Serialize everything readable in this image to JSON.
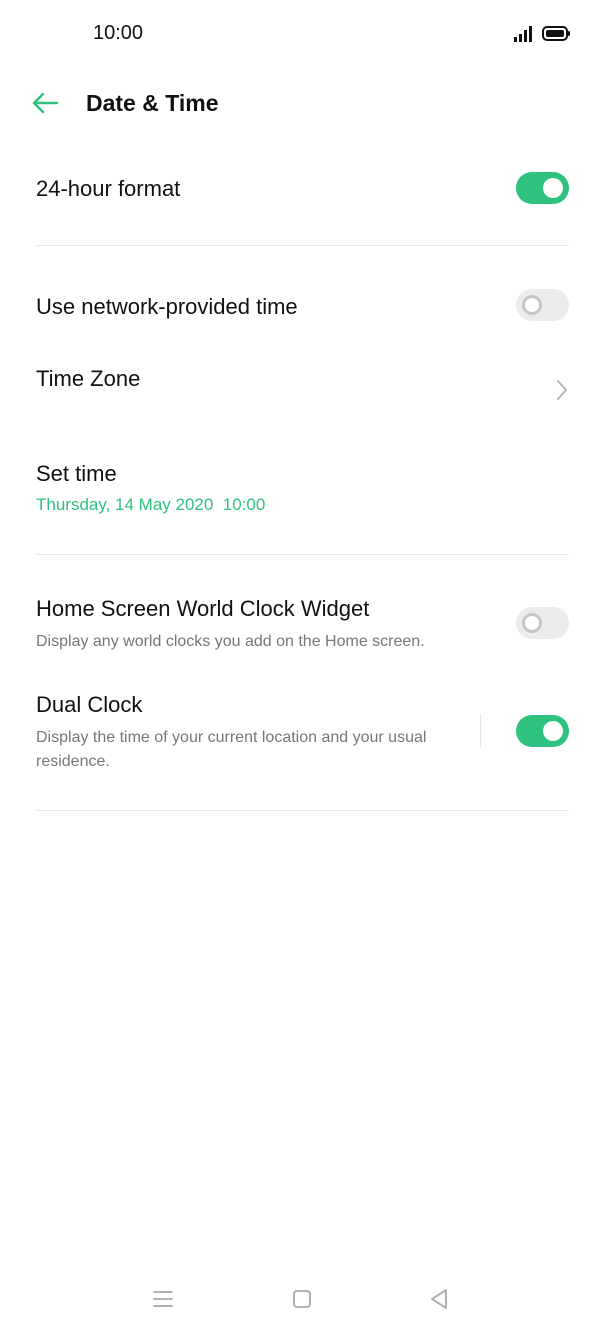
{
  "status_bar": {
    "time": "10:00",
    "icons": [
      "signal-icon",
      "battery-icon"
    ]
  },
  "header": {
    "back_icon": "back-arrow-icon",
    "title": "Date & Time"
  },
  "settings": {
    "hour_format": {
      "title": "24-hour format",
      "enabled": true
    },
    "network_time": {
      "title": "Use network-provided time",
      "enabled": false
    },
    "time_zone": {
      "title": "Time Zone"
    },
    "set_time": {
      "title": "Set time",
      "value": "Thursday, 14 May 2020  10:00"
    },
    "world_clock": {
      "title": "Home Screen World Clock Widget",
      "description": "Display any world clocks you add on the Home screen.",
      "enabled": false
    },
    "dual_clock": {
      "title": "Dual Clock",
      "description": "Display the time of your current location and your usual residence.",
      "enabled": true
    }
  },
  "nav_bar": {
    "icons": [
      "menu-icon",
      "home-icon",
      "back-triangle-icon"
    ]
  },
  "colors": {
    "accent": "#2ec27e",
    "toggle_off": "#ececec",
    "divider": "#e8e8e8",
    "secondary_text": "#777777"
  }
}
